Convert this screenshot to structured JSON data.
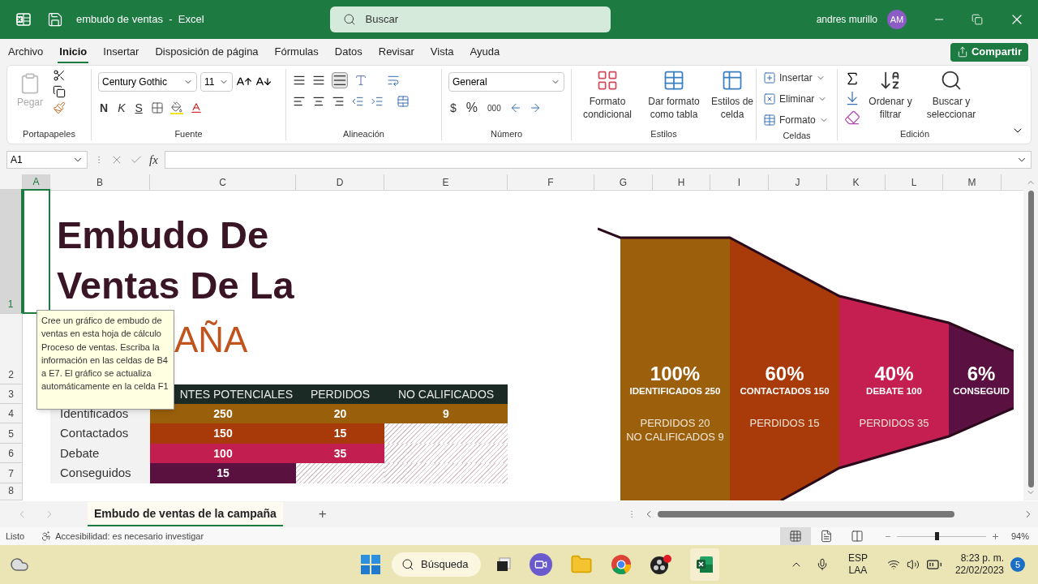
{
  "title_bar": {
    "title": "embudo de ventas  -  Excel",
    "search_placeholder": "Buscar",
    "user": "andres murillo",
    "avatar": "AM"
  },
  "menu": {
    "tabs": [
      {
        "label": "Archivo",
        "selected": false
      },
      {
        "label": "Inicio",
        "selected": true
      },
      {
        "label": "Insertar",
        "selected": false
      },
      {
        "label": "Disposición de página",
        "selected": false
      },
      {
        "label": "Fórmulas",
        "selected": false
      },
      {
        "label": "Datos",
        "selected": false
      },
      {
        "label": "Revisar",
        "selected": false
      },
      {
        "label": "Vista",
        "selected": false
      },
      {
        "label": "Ayuda",
        "selected": false
      }
    ],
    "share": "Compartir"
  },
  "ribbon": {
    "clipboard": {
      "paste": "Pegar",
      "label": "Portapapeles"
    },
    "font": {
      "name": "Century Gothic",
      "size": "11",
      "bold": "N",
      "italic": "K",
      "underline": "S",
      "label": "Fuente"
    },
    "alignment": {
      "label": "Alineación"
    },
    "number": {
      "format": "General",
      "currency": "$",
      "percent": "%",
      "thousands": "000",
      "label": "Número"
    },
    "styles": {
      "buttons": [
        "Formato condicional",
        "Dar formato como tabla",
        "Estilos de celda"
      ],
      "label": "Estilos"
    },
    "cells": {
      "buttons": [
        "Insertar",
        "Eliminar",
        "Formato"
      ],
      "label": "Celdas"
    },
    "editing": {
      "buttons": [
        "Ordenar y filtrar",
        "Buscar y seleccionar"
      ],
      "label": "Edición"
    }
  },
  "formula_bar": {
    "name_box": "A1",
    "fx": "fx"
  },
  "sheet": {
    "columns": [
      {
        "label": "A",
        "selected": true
      },
      {
        "label": "B",
        "selected": false
      },
      {
        "label": "C",
        "selected": false
      },
      {
        "label": "D",
        "selected": false
      },
      {
        "label": "E",
        "selected": false
      },
      {
        "label": "F",
        "selected": false
      },
      {
        "label": "G",
        "selected": false
      },
      {
        "label": "H",
        "selected": false
      },
      {
        "label": "I",
        "selected": false
      },
      {
        "label": "J",
        "selected": false
      },
      {
        "label": "K",
        "selected": false
      },
      {
        "label": "L",
        "selected": false
      },
      {
        "label": "M",
        "selected": false
      }
    ],
    "rows": [
      {
        "label": "1",
        "selected": true
      },
      {
        "label": "2",
        "selected": false
      },
      {
        "label": "3",
        "selected": false
      },
      {
        "label": "4",
        "selected": false
      },
      {
        "label": "5",
        "selected": false
      },
      {
        "label": "6",
        "selected": false
      },
      {
        "label": "7",
        "selected": false
      },
      {
        "label": "8",
        "selected": false
      }
    ],
    "title_lines": [
      "Embudo De",
      "Ventas De La"
    ],
    "title_visible_end": "AÑA",
    "table": {
      "headers": [
        "NTES POTENCIALES",
        "PERDIDOS",
        "NO CALIFICADOS"
      ],
      "rows": [
        {
          "label": "Identificados",
          "color": "#9a5f0b",
          "values": [
            "250",
            "20",
            "9"
          ]
        },
        {
          "label": "Contactados",
          "color": "#a83a0a",
          "values": [
            "150",
            "15"
          ]
        },
        {
          "label": "Debate",
          "color": "#c21e50",
          "values": [
            "100",
            "35"
          ]
        },
        {
          "label": "Conseguidos",
          "color": "#5a1140",
          "values": [
            "15"
          ]
        }
      ]
    },
    "comment": "Cree un gráfico de embudo de ventas en esta hoja de cálculo Proceso de ventas. Escriba la información en las celdas de B4 a E7. El gráfico se actualiza automáticamente en la celda F1",
    "funnel": {
      "stages": [
        {
          "percent": "100%",
          "label": "IDENTIFICADOS 250",
          "details": [
            "PERDIDOS 20",
            "NO CALIFICADOS 9"
          ],
          "color": "#9c5f0c"
        },
        {
          "percent": "60%",
          "label": "CONTACTADOS 150",
          "details": [
            "PERDIDOS 15"
          ],
          "color": "#a93a0a"
        },
        {
          "percent": "40%",
          "label": "DEBATE 100",
          "details": [
            "PERDIDOS 35"
          ],
          "color": "#c41f50"
        },
        {
          "percent": "6%",
          "label": "CONSEGUID",
          "color": "#5a1141"
        }
      ]
    }
  },
  "sheet_tabs": [
    {
      "label": "Embudo de ventas de la campaña",
      "selected": true
    }
  ],
  "add_sheet": "+",
  "status_bar": {
    "ready": "Listo",
    "accessibility": "Accesibilidad: es necesario investigar",
    "views": [
      {
        "kind": "normal",
        "selected": true
      },
      {
        "kind": "page_layout",
        "selected": false
      },
      {
        "kind": "page_break",
        "selected": false
      }
    ],
    "zoom": {
      "level": 0.45,
      "reading": "94%"
    }
  },
  "taskbar": {
    "search": "Búsqueda",
    "language": [
      "ESP",
      "LAA"
    ],
    "time": "8:23 p. m.",
    "date": "22/02/2023",
    "notifications": "5"
  }
}
